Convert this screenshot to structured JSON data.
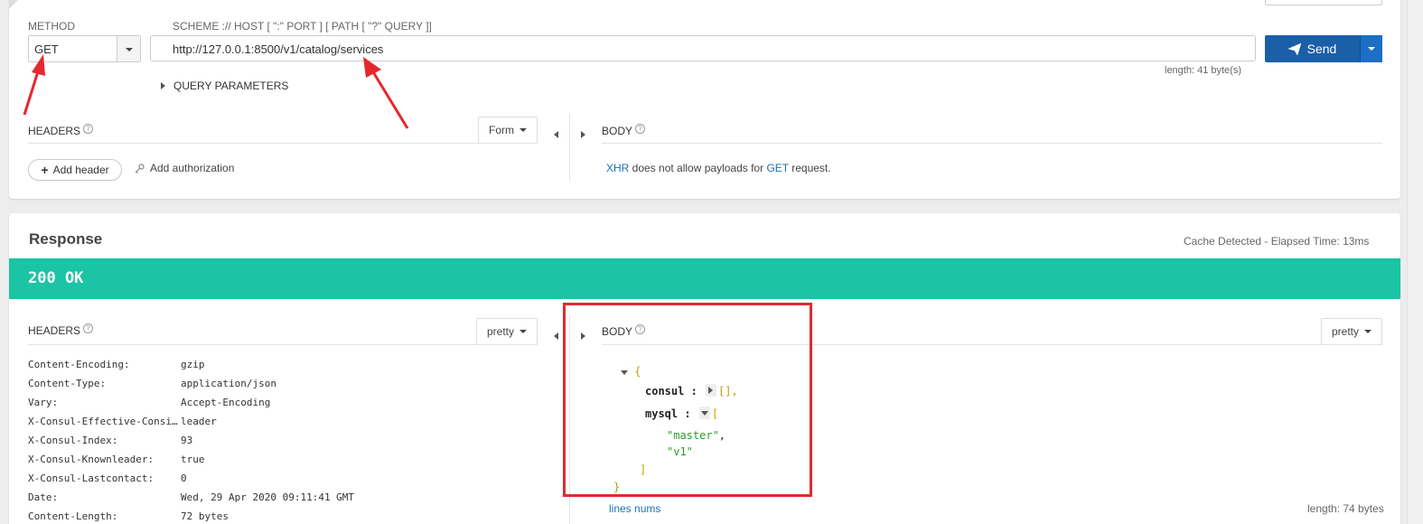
{
  "request": {
    "method_label": "METHOD",
    "method_value": "GET",
    "url_hint": "SCHEME :// HOST [ \":\" PORT ] [ PATH [ \"?\" QUERY ]]",
    "url_value": "http://127.0.0.1:8500/v1/catalog/services",
    "send_label": "Send",
    "length_text": "length: 41 byte(s)",
    "query_params_label": "QUERY PARAMETERS",
    "headers_label": "HEADERS",
    "headers_mode": "Form",
    "add_header_label": "Add header",
    "add_auth_label": "Add authorization",
    "body_label": "BODY",
    "body_note": {
      "xhr": "XHR",
      "middle": " does not allow payloads for ",
      "get": "GET",
      "end": " request."
    }
  },
  "response": {
    "title": "Response",
    "elapsed": "Cache Detected - Elapsed Time: 13ms",
    "status": "200 OK",
    "headers_label": "HEADERS",
    "headers_mode": "pretty",
    "body_label": "BODY",
    "body_mode": "pretty",
    "headers": [
      {
        "key": "Content-Encoding:",
        "value": "gzip"
      },
      {
        "key": "Content-Type:",
        "value": "application/json"
      },
      {
        "key": "Vary:",
        "value": "Accept-Encoding"
      },
      {
        "key": "X-Consul-Effective-Consi…",
        "value": "leader"
      },
      {
        "key": "X-Consul-Index:",
        "value": "93"
      },
      {
        "key": "X-Consul-Knownleader:",
        "value": "true"
      },
      {
        "key": "X-Consul-Lastcontact:",
        "value": "0"
      },
      {
        "key": "Date:",
        "value": "Wed, 29 Apr 2020 09:11:41 GMT"
      },
      {
        "key": "Content-Length:",
        "value": "72 bytes"
      }
    ],
    "json": {
      "open": "{",
      "consul_key": "consul",
      "colon": " :",
      "consul_value": "[],",
      "mysql_key": "mysql",
      "mysql_open": "[",
      "item1": "\"master\"",
      "comma": ",",
      "item2": "\"v1\"",
      "mysql_close": "]",
      "close": "}"
    },
    "lines_nums": "lines nums",
    "length_text": "length: 74 bytes"
  },
  "colors": {
    "status_bar": "#1bc4a4",
    "send_button": "#1a5fa8",
    "annotation_red": "#e5282e"
  }
}
